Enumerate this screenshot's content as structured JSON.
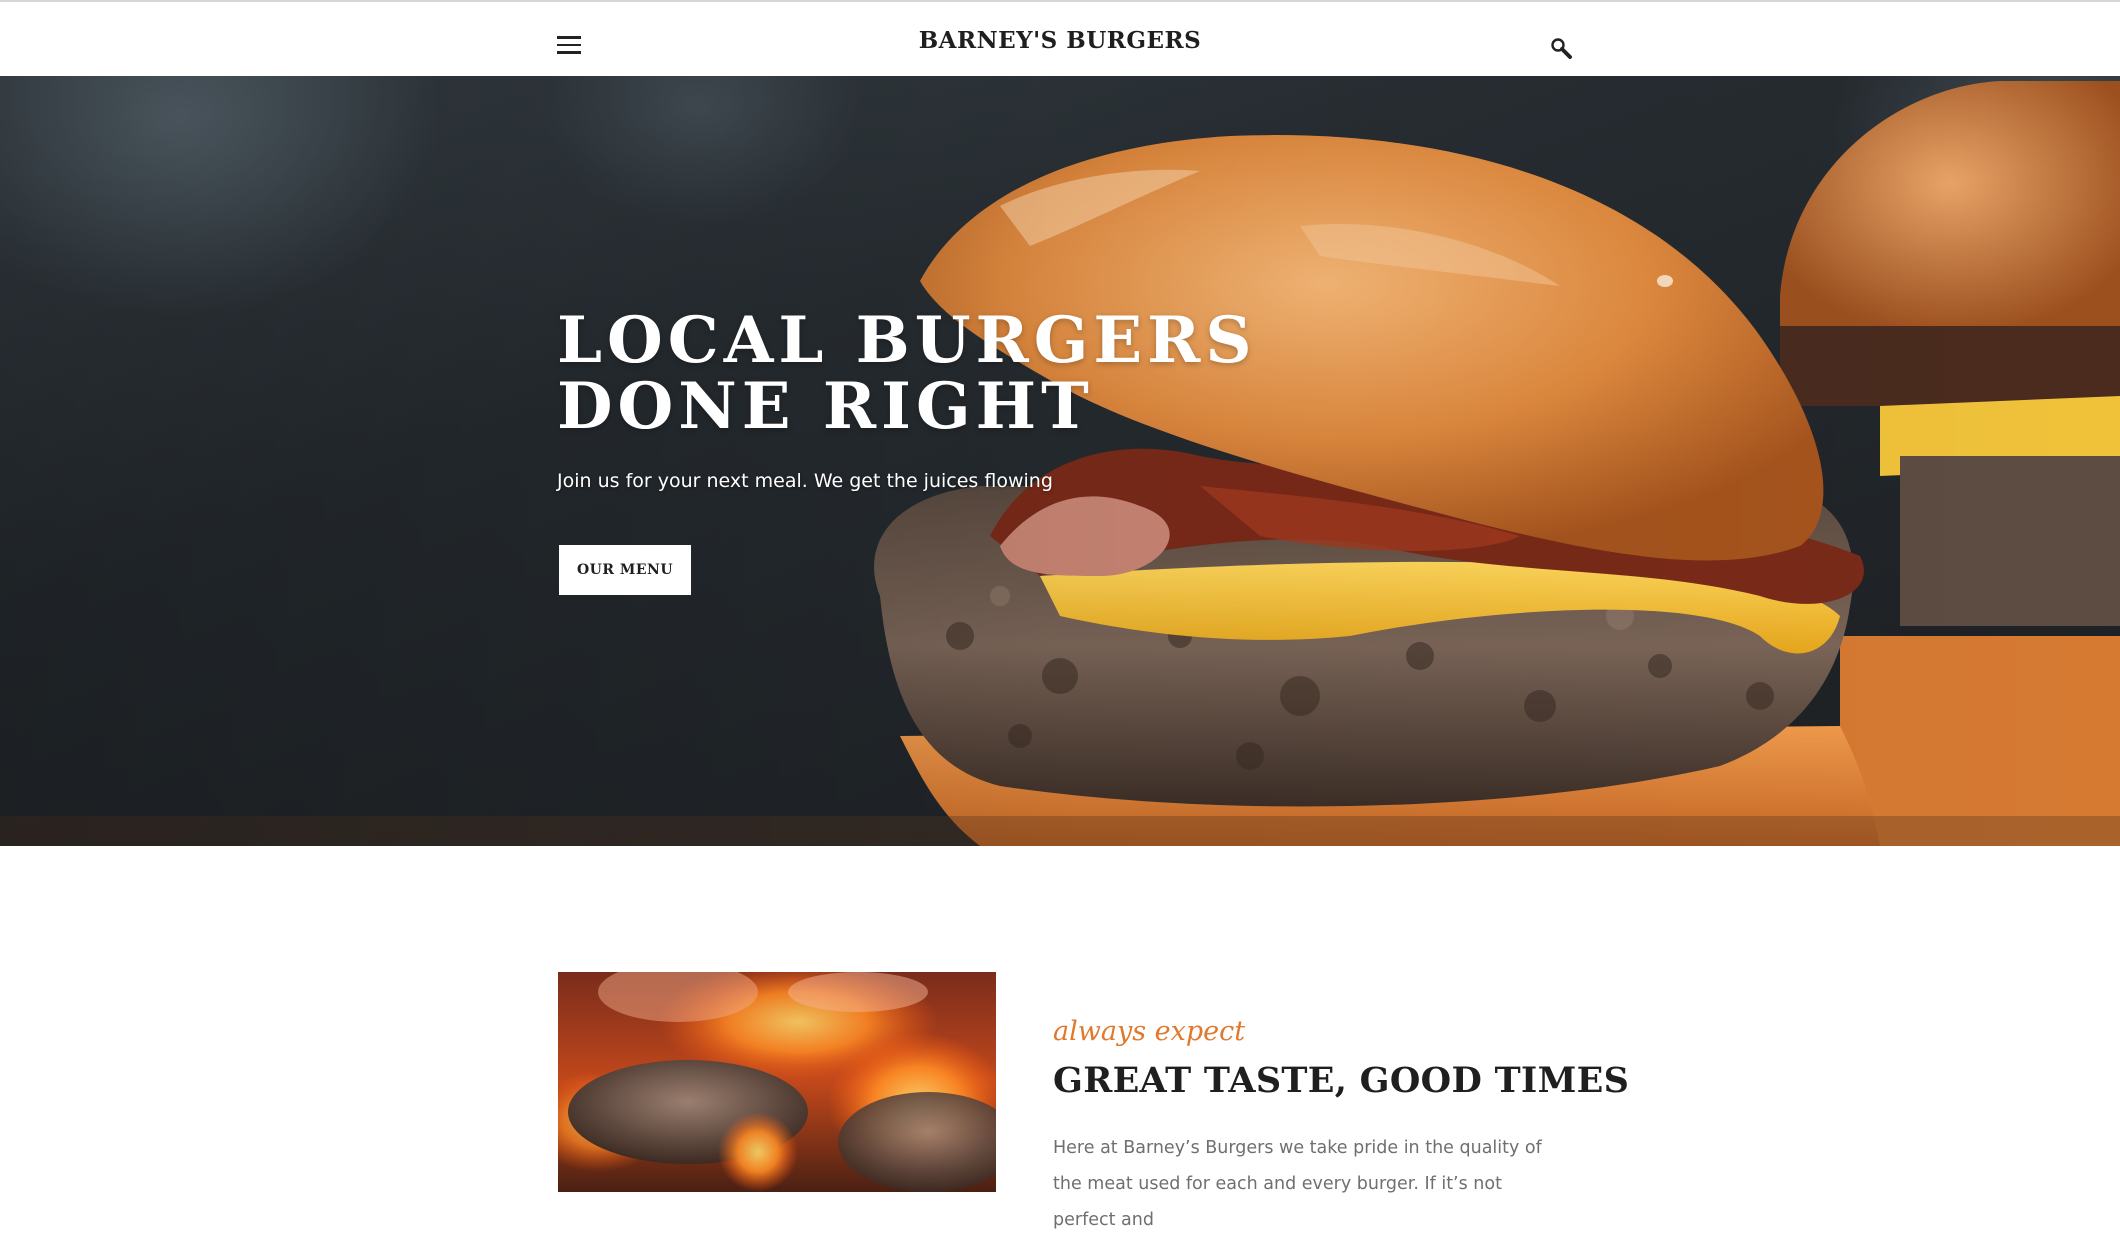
{
  "header": {
    "site_title": "BARNEY'S BURGERS",
    "menu_icon": "hamburger-menu-icon",
    "search_icon": "search-icon"
  },
  "hero": {
    "title": "LOCAL BURGERS\nDONE RIGHT",
    "subtitle": "Join us for your next meal. We get the juices flowing",
    "button_label": "OUR MENU"
  },
  "intro": {
    "kicker": "always expect",
    "title": "GREAT TASTE, GOOD TIMES",
    "body": "Here at Barney’s Burgers we take pride in the quality of the meat used for each and every burger. If it’s not perfect and"
  },
  "colors": {
    "accent": "#e0792c",
    "text_dark": "#1f1f1f",
    "text_muted": "#6f6f6f"
  }
}
